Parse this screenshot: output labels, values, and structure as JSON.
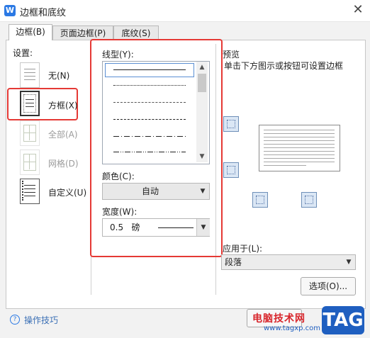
{
  "window": {
    "title": "边框和底纹",
    "app_icon": "W"
  },
  "tabs": [
    {
      "label": "边框(B)",
      "active": true
    },
    {
      "label": "页面边框(P)",
      "active": false
    },
    {
      "label": "底纹(S)",
      "active": false
    }
  ],
  "settings": {
    "title": "设置:",
    "items": [
      {
        "label": "无(N)",
        "enabled": true,
        "icon": "none-icon"
      },
      {
        "label": "方框(X)",
        "enabled": true,
        "icon": "box-icon",
        "highlighted": true
      },
      {
        "label": "全部(A)",
        "enabled": false,
        "icon": "all-icon"
      },
      {
        "label": "网格(D)",
        "enabled": false,
        "icon": "grid-icon"
      },
      {
        "label": "自定义(U)",
        "enabled": true,
        "icon": "custom-icon"
      }
    ]
  },
  "line_style": {
    "title": "线型(Y):",
    "options": [
      "solid",
      "dotted",
      "dashed-small",
      "dashed",
      "dash-dot",
      "dash-dot-dot"
    ],
    "selected_index": 0
  },
  "color": {
    "title": "颜色(C):",
    "value": "自动"
  },
  "width": {
    "title": "宽度(W):",
    "value": "0.5   磅"
  },
  "preview": {
    "title": "预览",
    "hint": "单击下方图示或按钮可设置边框"
  },
  "apply_to": {
    "title": "应用于(L):",
    "value": "段落"
  },
  "buttons": {
    "options": "选项(O)..."
  },
  "footer": {
    "help": "操作技巧"
  },
  "watermark": {
    "text": "电脑技术网",
    "url": "www.tagxp.com",
    "logo": "TAG"
  },
  "colors": {
    "accent": "#2b79e4",
    "highlight": "#e53935"
  }
}
